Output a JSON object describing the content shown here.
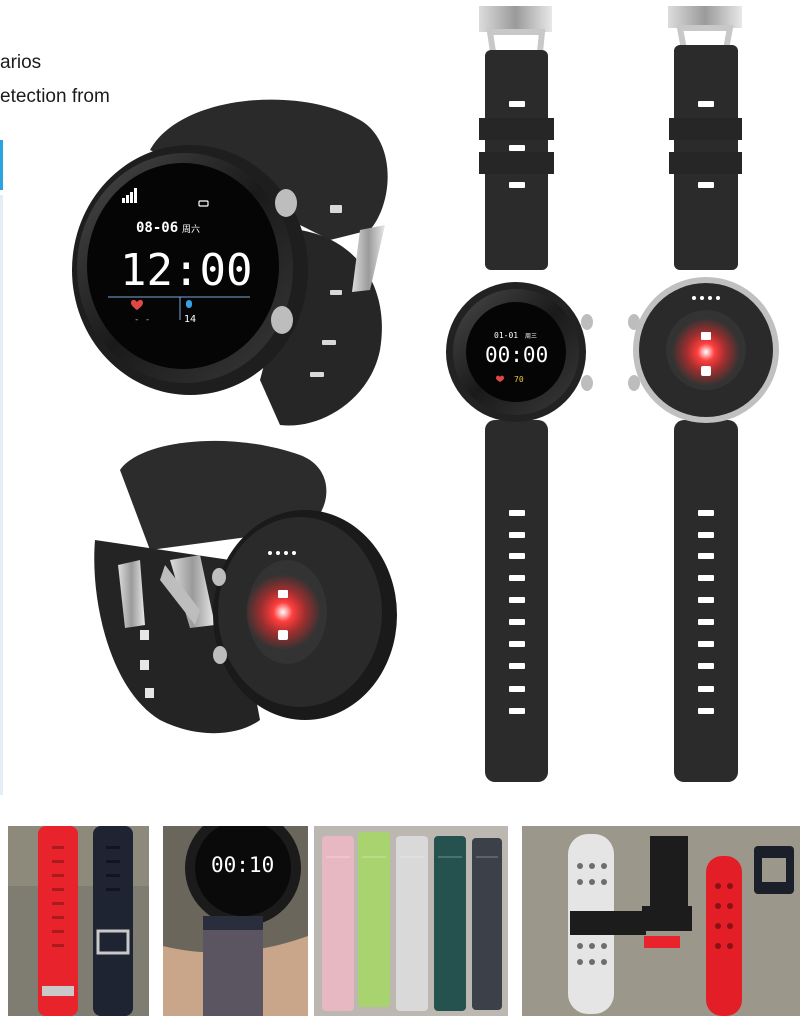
{
  "page": {
    "fragment_line1": "arios",
    "fragment_line2": "etection from"
  },
  "watch_front": {
    "signal_icon": "signal-bars-icon",
    "battery_icon": "battery-icon",
    "date": "08-06",
    "weekday": "周六",
    "time": "12:00",
    "heart_icon": "heart-icon",
    "heart_value": "- -",
    "steps_icon": "footprint-icon",
    "steps_value": "14"
  },
  "watch_upright": {
    "date": "01-01",
    "weekday": "周三",
    "time": "00:00",
    "heart_value": "70"
  },
  "wrist_photo": {
    "time": "00:10"
  },
  "colors": {
    "strap": "#2b2b2b",
    "sensor_red": "#ff2a2a",
    "edge_accent": "#2aa3e0",
    "red_strap": "#e8232b",
    "navy_strap": "#1f2433"
  }
}
